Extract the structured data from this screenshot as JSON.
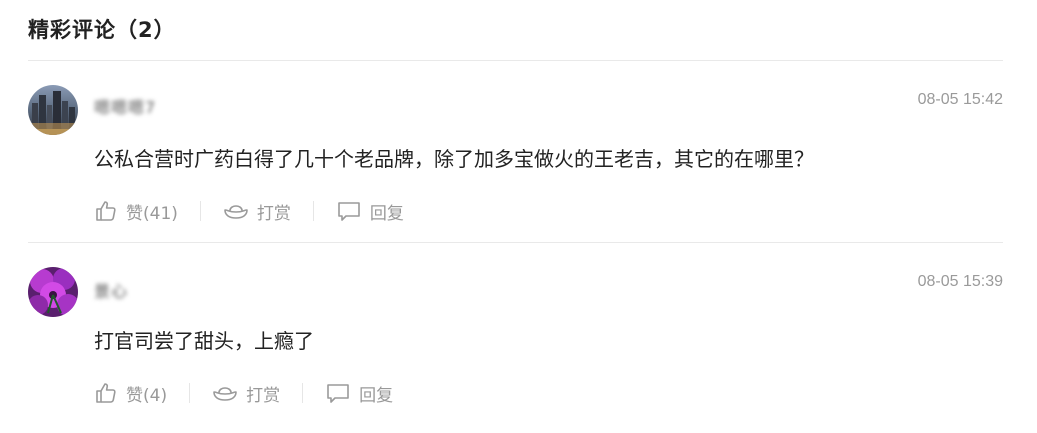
{
  "header": {
    "title": "精彩评论（2）"
  },
  "comments": [
    {
      "username": "嗯嗯嗯7",
      "time": "08-05 15:42",
      "text": "公私合营时广药白得了几十个老品牌，除了加多宝做火的王老吉，其它的在哪里？",
      "like_label": "赞(41)",
      "reward_label": "打赏",
      "reply_label": "回复"
    },
    {
      "username": "景心",
      "time": "08-05 15:39",
      "text": "打官司尝了甜头，上瘾了",
      "like_label": "赞(4)",
      "reward_label": "打赏",
      "reply_label": "回复"
    }
  ]
}
